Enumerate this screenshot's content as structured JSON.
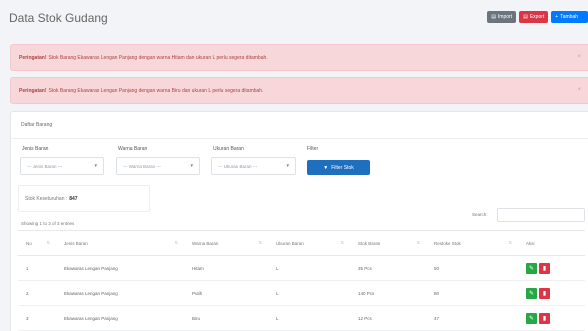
{
  "page": {
    "title": "Data Stok Gudang"
  },
  "toolbar": {
    "btn1": "Import",
    "btn2": "Export",
    "btn3": "Tambah"
  },
  "alerts": [
    {
      "strong": "Peringatan!",
      "text": "Stok Barang Ekawaras Lengan Panjang dengan warna Hitam dan ukuran L perlu segera ditambah."
    },
    {
      "strong": "Peringatan!",
      "text": "Stok Barang Ekawaras Lengan Panjang dengan warna Biru dan ukuran L perlu segera ditambah."
    }
  ],
  "card": {
    "title": "Daftar Barang"
  },
  "filters": {
    "jenis": {
      "label": "Jenis Baran",
      "value": "--- Jenis Baran ---"
    },
    "warna": {
      "label": "Warna Baran",
      "value": "--- Warna Baran ---"
    },
    "ukuran": {
      "label": "Ukuran Baran",
      "value": "--- Ukuran Baran ---"
    },
    "filter": {
      "label": "Filter",
      "button": "Filter Stok"
    }
  },
  "total": {
    "label": "Stok Keseluruhan :",
    "value": "847"
  },
  "table_info": {
    "showing": "Showing 1 to 3 of 3 entries",
    "search_label": "Search:"
  },
  "table": {
    "columns": [
      "No",
      "Jenis Baran",
      "Warna Baran",
      "Ukuran Baran",
      "Stok Baran",
      "Restoke Stok",
      "Aksi"
    ],
    "rows": [
      [
        "1",
        "Ekawaras Lengan Panjang",
        "Hitam",
        "L",
        "35 Pcs",
        "50"
      ],
      [
        "2",
        "Ekawaras Lengan Panjang",
        "Putih",
        "L",
        "140 Pcs",
        "80"
      ],
      [
        "3",
        "Ekawaras Lengan Panjang",
        "Biru",
        "L",
        "12 Pcs",
        "47"
      ]
    ]
  }
}
